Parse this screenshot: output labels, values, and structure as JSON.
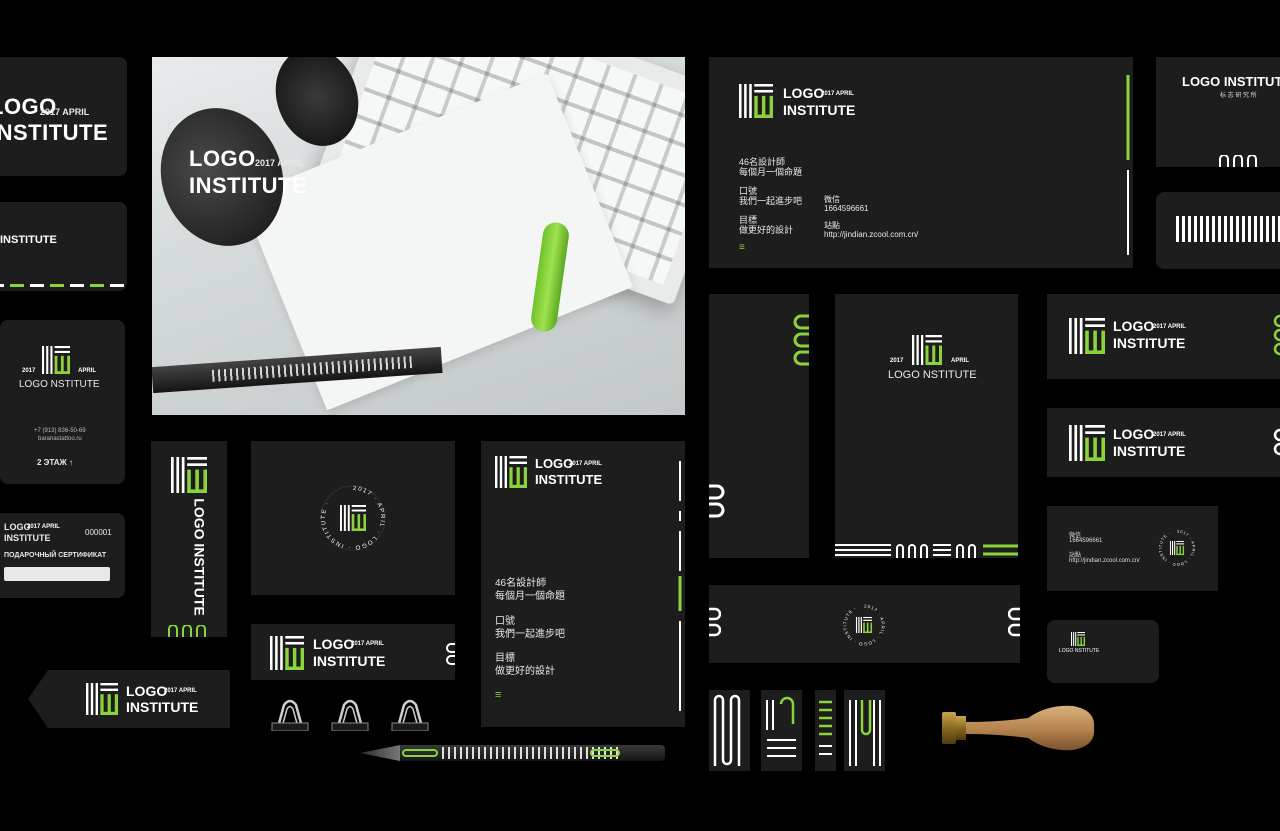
{
  "brand": {
    "logo_line1": "LOGO",
    "logo_line2": "INSTITUTE",
    "date_year": "2017",
    "date_month": "APRIL",
    "date_inline": "2017 APRIL",
    "logo_nstitute": "LOGO NSTITUTE",
    "logo_full": "LOGO INSTITUTE",
    "chinese_name": "标 志 研 究 所",
    "seal_text": "2017 · APRIL · LOGO · INSTITUTE ·"
  },
  "info": {
    "line1": "46名設計師",
    "line2": "每個月一個命題",
    "slogan_label": "口號",
    "slogan_text": "我們一起進步吧",
    "goal_label": "目標",
    "goal_text": "做更好的設計",
    "wechat_label": "微信",
    "wechat_value": "1664596661",
    "site_label": "站點",
    "site_value": "http://jindian.zcool.com.cn/",
    "menu_glyph": "≡"
  },
  "russian_card": {
    "phone": "+7 (913) 836-50-69",
    "site": "baranastattoo.ru",
    "floor": "2 ЭТАЖ ↑"
  },
  "gift_card": {
    "number": "000001",
    "title": "ПОДАРОЧНЫЙ СЕРТИФИКАТ"
  },
  "colors": {
    "background": "#000000",
    "card": "#1d1d1d",
    "accent": "#8bd33a",
    "text": "#ffffff"
  },
  "icons": [
    "logo-mark-icon",
    "seal-emblem-icon",
    "binder-clip-icon",
    "pencil-icon",
    "wax-stamp-icon",
    "pattern-icon"
  ]
}
